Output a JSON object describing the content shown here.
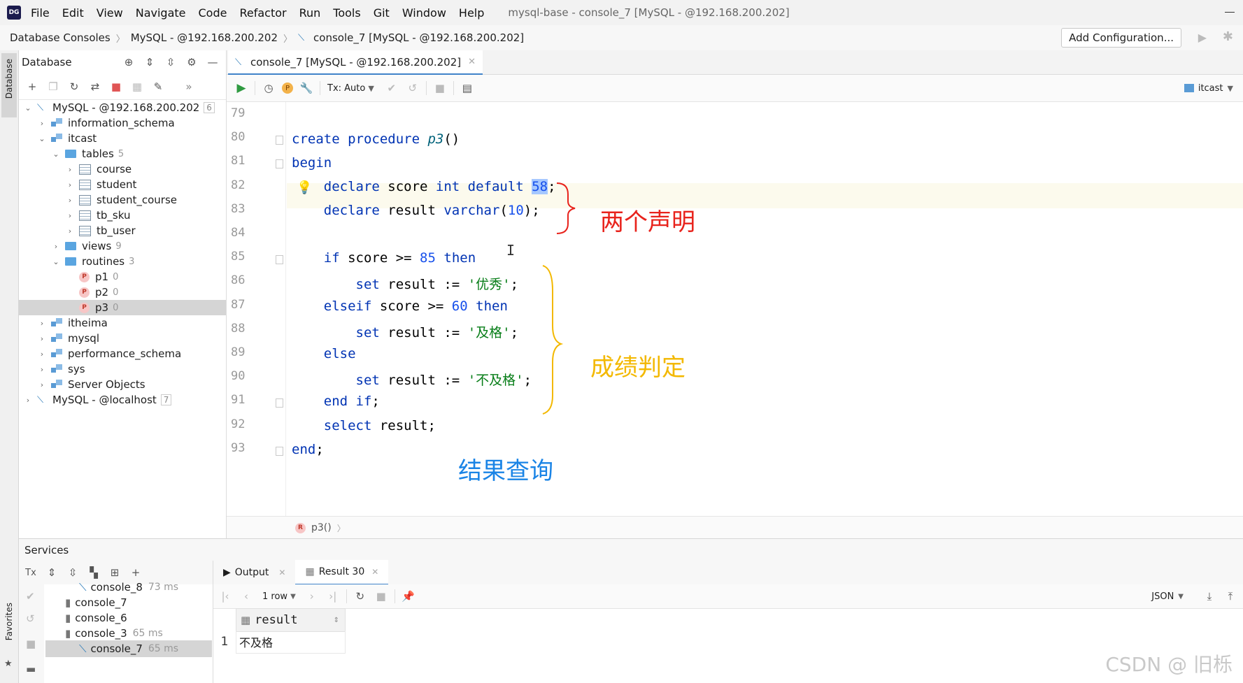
{
  "menubar": {
    "logo": "DG",
    "items": [
      "File",
      "Edit",
      "View",
      "Navigate",
      "Code",
      "Refactor",
      "Run",
      "Tools",
      "Git",
      "Window",
      "Help"
    ],
    "window_title": "mysql-base - console_7 [MySQL - @192.168.200.202]"
  },
  "navbar": {
    "breadcrumbs": [
      "Database Consoles",
      "MySQL - @192.168.200.202",
      "console_7 [MySQL - @192.168.200.202]"
    ],
    "add_configuration": "Add Configuration..."
  },
  "left_stripe": {
    "database": "Database",
    "favorites": "Favorites"
  },
  "db_panel": {
    "title": "Database",
    "tree": [
      {
        "label": "MySQL - @192.168.200.202",
        "count": "6",
        "level": 0,
        "kind": "conn",
        "arrow": "open"
      },
      {
        "label": "information_schema",
        "level": 1,
        "kind": "schema",
        "arrow": "closed"
      },
      {
        "label": "itcast",
        "level": 1,
        "kind": "schema",
        "arrow": "open"
      },
      {
        "label": "tables",
        "count": "5",
        "level": 2,
        "kind": "folder",
        "arrow": "open"
      },
      {
        "label": "course",
        "level": 3,
        "kind": "table",
        "arrow": "closed"
      },
      {
        "label": "student",
        "level": 3,
        "kind": "table",
        "arrow": "closed"
      },
      {
        "label": "student_course",
        "level": 3,
        "kind": "table",
        "arrow": "closed"
      },
      {
        "label": "tb_sku",
        "level": 3,
        "kind": "table",
        "arrow": "closed"
      },
      {
        "label": "tb_user",
        "level": 3,
        "kind": "table",
        "arrow": "closed"
      },
      {
        "label": "views",
        "count": "9",
        "level": 2,
        "kind": "folder",
        "arrow": "closed"
      },
      {
        "label": "routines",
        "count": "3",
        "level": 2,
        "kind": "folder",
        "arrow": "open"
      },
      {
        "label": "p1",
        "count": "0",
        "level": 3,
        "kind": "proc",
        "arrow": "none"
      },
      {
        "label": "p2",
        "count": "0",
        "level": 3,
        "kind": "proc",
        "arrow": "none"
      },
      {
        "label": "p3",
        "count": "0",
        "level": 3,
        "kind": "proc",
        "arrow": "none",
        "selected": true
      },
      {
        "label": "itheima",
        "level": 1,
        "kind": "schema",
        "arrow": "closed"
      },
      {
        "label": "mysql",
        "level": 1,
        "kind": "schema",
        "arrow": "closed"
      },
      {
        "label": "performance_schema",
        "level": 1,
        "kind": "schema",
        "arrow": "closed"
      },
      {
        "label": "sys",
        "level": 1,
        "kind": "schema",
        "arrow": "closed"
      },
      {
        "label": "Server Objects",
        "level": 1,
        "kind": "schema",
        "arrow": "closed"
      },
      {
        "label": "MySQL - @localhost",
        "count": "7",
        "level": 0,
        "kind": "conn",
        "arrow": "closed"
      }
    ]
  },
  "editor": {
    "tab": "console_7 [MySQL - @192.168.200.202]",
    "tx_mode": "Tx: Auto",
    "schema": "itcast",
    "line_numbers": [
      "79",
      "80",
      "81",
      "82",
      "83",
      "84",
      "85",
      "86",
      "87",
      "88",
      "89",
      "90",
      "91",
      "92",
      "93"
    ],
    "status_proc": "p3()",
    "annotations": {
      "declarations": "两个声明",
      "grading": "成绩判定",
      "query": "结果查询"
    }
  },
  "services": {
    "title": "Services",
    "tree": [
      {
        "label": "console_8",
        "time": "73 ms",
        "indent": 2
      },
      {
        "label": "console_7",
        "time": "",
        "indent": 1
      },
      {
        "label": "console_6",
        "time": "",
        "indent": 1
      },
      {
        "label": "console_3",
        "time": "65 ms",
        "indent": 1
      },
      {
        "label": "console_7",
        "time": "65 ms",
        "indent": 2,
        "selected": true
      }
    ],
    "tabs": {
      "output": "Output",
      "result": "Result 30"
    },
    "rows_label": "1 row",
    "format": "JSON",
    "column": "result",
    "row_number": "1",
    "value": "不及格"
  },
  "watermark": "CSDN @ 旧栎"
}
